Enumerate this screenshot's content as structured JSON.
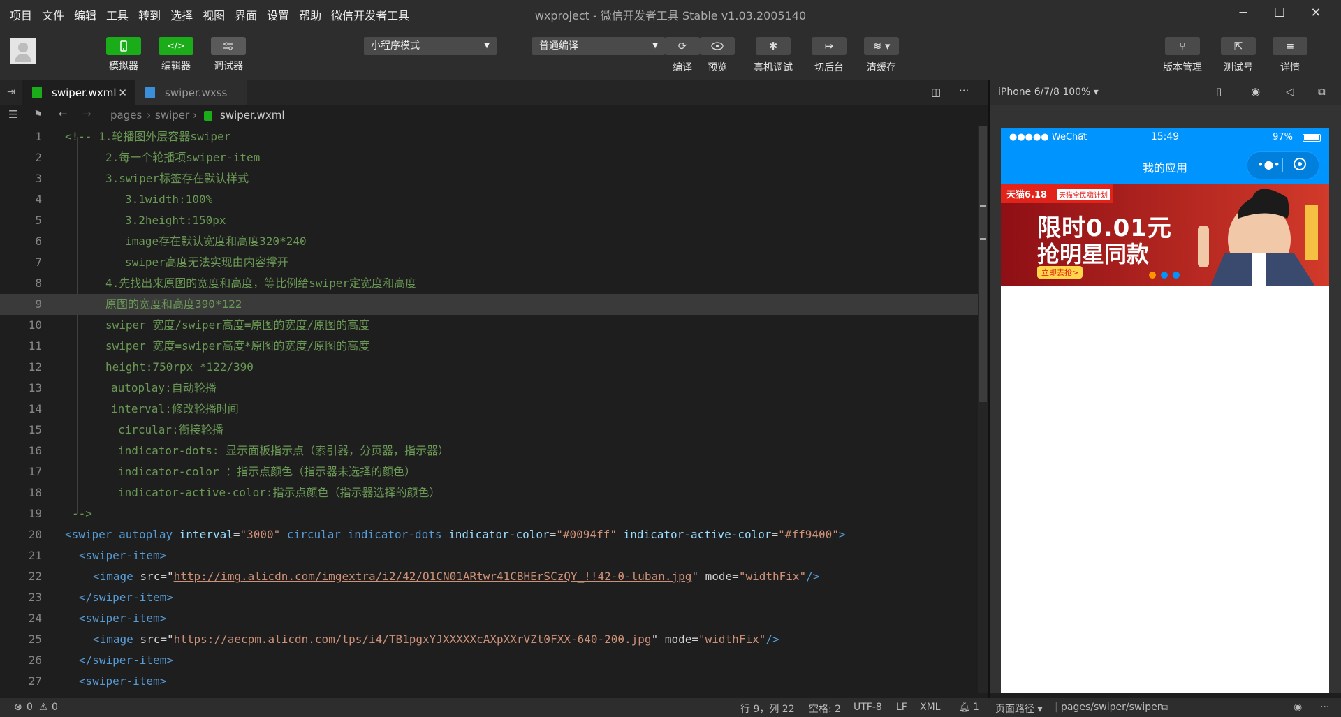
{
  "menu": [
    "项目",
    "文件",
    "编辑",
    "工具",
    "转到",
    "选择",
    "视图",
    "界面",
    "设置",
    "帮助",
    "微信开发者工具"
  ],
  "window_title": "wxproject - 微信开发者工具 Stable v1.03.2005140",
  "toolbar": {
    "simulator": "模拟器",
    "editor": "编辑器",
    "debugger": "调试器",
    "mode_select": "小程序模式",
    "compile_select": "普通编译",
    "compile": "编译",
    "preview": "预览",
    "real_debug": "真机调试",
    "background": "切后台",
    "clear_cache": "清缓存",
    "version": "版本管理",
    "test_account": "测试号",
    "details": "详情"
  },
  "tabs": [
    {
      "label": "swiper.wxml",
      "active": true
    },
    {
      "label": "swiper.wxss",
      "active": false
    }
  ],
  "breadcrumb": {
    "p1": "pages",
    "p2": "swiper",
    "p3": "swiper.wxml"
  },
  "code_lines": [
    {
      "n": "1",
      "code": "<!-- 1.轮播图外层容器swiper"
    },
    {
      "n": "2",
      "code": "2.每一个轮播项swiper-item"
    },
    {
      "n": "3",
      "code": "3.swiper标签存在默认样式"
    },
    {
      "n": "4",
      "code": "3.1width:100%"
    },
    {
      "n": "5",
      "code": "3.2height:150px"
    },
    {
      "n": "6",
      "code": "image存在默认宽度和高度320*240"
    },
    {
      "n": "7",
      "code": "swiper高度无法实现由内容撑开"
    },
    {
      "n": "8",
      "code": "4.先找出来原图的宽度和高度，等比例给swiper定宽度和高度"
    },
    {
      "n": "9",
      "code": "原图的宽度和高度390*122"
    },
    {
      "n": "10",
      "code": "swiper 宽度/swiper高度=原图的宽度/原图的高度"
    },
    {
      "n": "11",
      "code": "swiper 宽度=swiper高度*原图的宽度/原图的高度"
    },
    {
      "n": "12",
      "code": "height:750rpx *122/390"
    },
    {
      "n": "13",
      "code": "autoplay:自动轮播"
    },
    {
      "n": "14",
      "code": "interval:修改轮播时间"
    },
    {
      "n": "15",
      "code": "circular:衔接轮播"
    },
    {
      "n": "16",
      "code": "indicator-dots: 显示面板指示点（索引器，分页器，指示器）"
    },
    {
      "n": "17",
      "code": "indicator-color ：指示点颜色（指示器未选择的颜色）"
    },
    {
      "n": "18",
      "code": "indicator-active-color:指示点颜色（指示器选择的颜色）"
    },
    {
      "n": "19",
      "code": "-->"
    },
    {
      "n": "20",
      "code": ""
    },
    {
      "n": "21",
      "code": "<swiper-item>"
    },
    {
      "n": "22",
      "code": ""
    },
    {
      "n": "23",
      "code": "</swiper-item>"
    },
    {
      "n": "24",
      "code": "<swiper-item>"
    },
    {
      "n": "25",
      "code": ""
    },
    {
      "n": "26",
      "code": "</swiper-item>"
    },
    {
      "n": "27",
      "code": "<swiper-item>"
    }
  ],
  "line20": {
    "tag": "<swiper",
    "a1": "autoplay",
    "a2": "interval",
    "v2": "\"3000\"",
    "a3": "circular",
    "a4": "indicator-dots",
    "a5": "indicator-color",
    "v5": "\"#0094ff\"",
    "a6": "indicator-active-color",
    "v6": "\"#ff9400\"",
    "close": ">"
  },
  "line22": {
    "tag": "<image",
    "attr": "src",
    "q": "\"",
    "url": "http://img.alicdn.com/imgextra/i2/42/O1CN01ARtwr41CBHErSCzQY_!!42-0-luban.jpg",
    "mode": "mode",
    "mv": "\"widthFix\"",
    "close": "/>"
  },
  "line25": {
    "tag": "<image",
    "attr": "src",
    "q": "\"",
    "url": "https://aecpm.alicdn.com/tps/i4/TB1pgxYJXXXXXcAXpXXrVZt0FXX-640-200.jpg",
    "mode": "mode",
    "mv": "\"widthFix\"",
    "close": "/>"
  },
  "simulator": {
    "device": "iPhone 6/7/8 100% ▾",
    "carrier": "●●●●● WeChat",
    "time": "15:49",
    "battery": "97%",
    "nav_title": "我的应用",
    "banner_tag1": "天猫6.18",
    "banner_tag2": "天猫全民嗨计划",
    "banner_line1": "限时0.01元",
    "banner_line2": "抢明星同款",
    "banner_btn": "立即去抢>"
  },
  "statusbar": {
    "errors": "0",
    "warnings": "0",
    "position": "行 9，列 22",
    "spaces": "空格: 2",
    "encoding": "UTF-8",
    "eol": "LF",
    "lang": "XML",
    "notifications": "1",
    "page_path_label": "页面路径 ▾",
    "page_path": "pages/swiper/swiper"
  },
  "colors": {
    "accent": "#1aad19",
    "wx_blue": "#0094ff",
    "dot_active": "#ff9400"
  }
}
